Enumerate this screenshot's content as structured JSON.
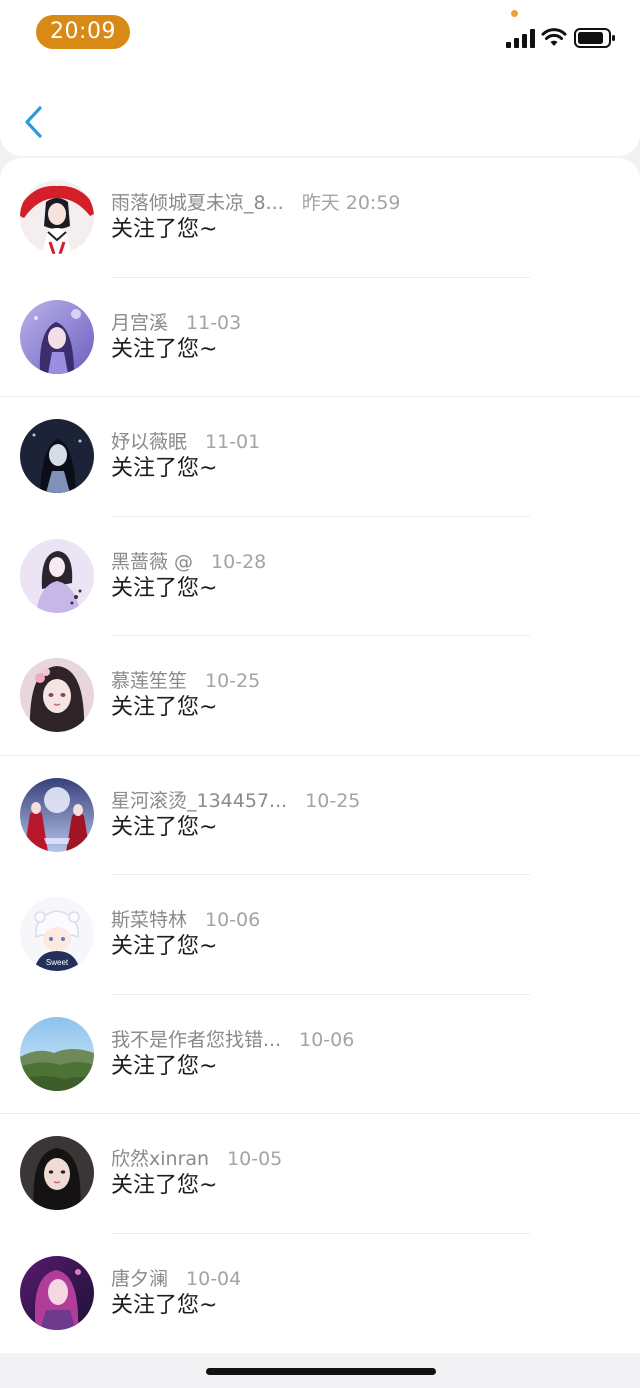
{
  "status_bar": {
    "time": "20:09",
    "colors": {
      "time_pill": "#d98a16",
      "mic_dot": "#f0a030"
    },
    "icons": [
      "cellular-signal-icon",
      "wifi-icon",
      "battery-icon"
    ]
  },
  "nav": {
    "back_icon": "chevron-left-icon",
    "back_color": "#2a9be0"
  },
  "notifications": [
    {
      "name": "雨落倾城夏未凉_8...",
      "time": "昨天 20:59",
      "message": "关注了您~"
    },
    {
      "name": "月宫溪",
      "time": "11-03",
      "message": "关注了您~"
    },
    {
      "name": "妤以薇眠",
      "time": "11-01",
      "message": "关注了您~"
    },
    {
      "name": "黑蔷薇 @",
      "time": "10-28",
      "message": "关注了您~"
    },
    {
      "name": "慕莲笙笙",
      "time": "10-25",
      "message": "关注了您~"
    },
    {
      "name": "星河滚烫_134457...",
      "time": "10-25",
      "message": "关注了您~"
    },
    {
      "name": "斯菜特林",
      "time": "10-06",
      "message": "关注了您~"
    },
    {
      "name": "我不是作者您找错...",
      "time": "10-06",
      "message": "关注了您~"
    },
    {
      "name": "欣然xinran",
      "time": "10-05",
      "message": "关注了您~"
    },
    {
      "name": "唐夕澜",
      "time": "10-04",
      "message": "关注了您~"
    }
  ],
  "avatar_labels": {
    "sweet": "Sweet"
  }
}
